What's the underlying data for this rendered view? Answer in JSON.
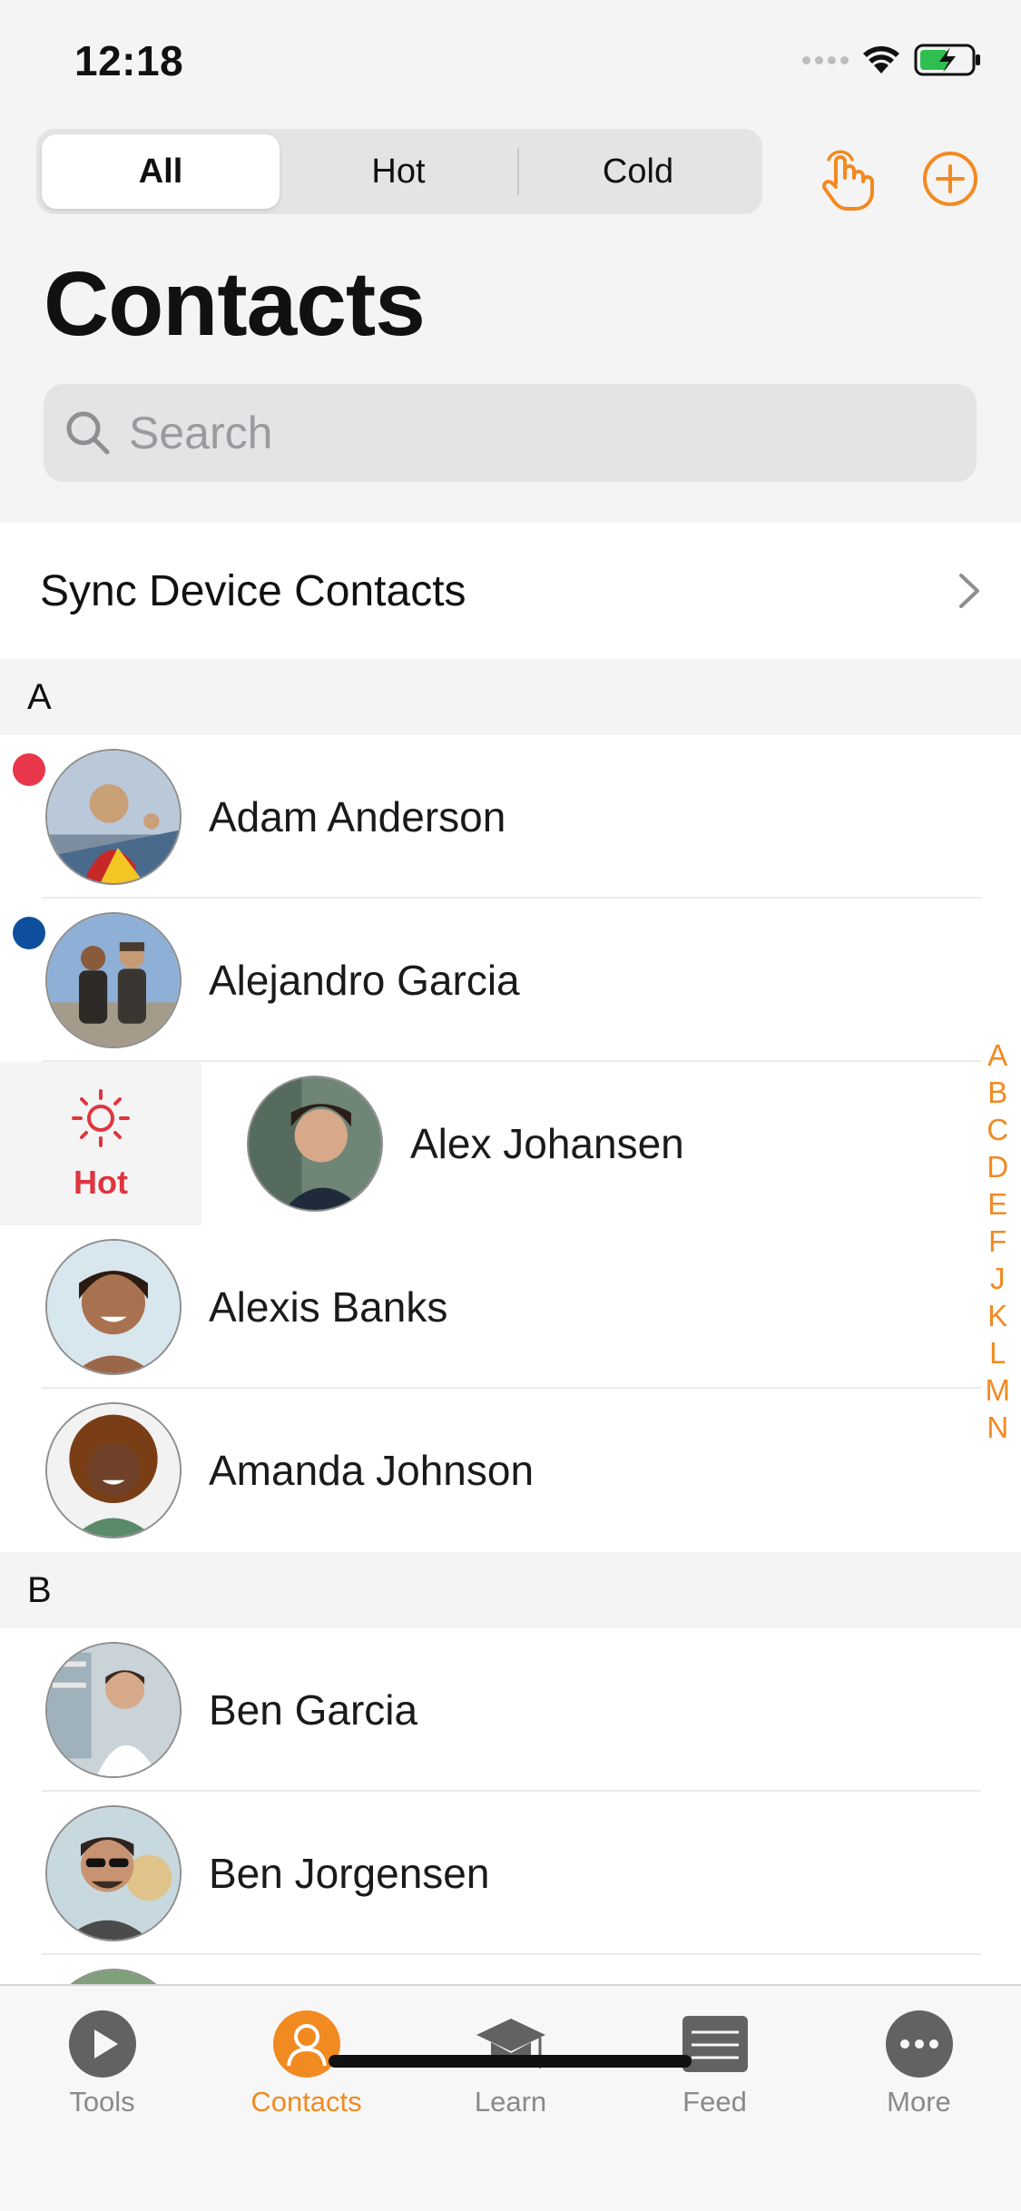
{
  "status_bar": {
    "time": "12:18"
  },
  "segments": {
    "items": [
      "All",
      "Hot",
      "Cold"
    ],
    "selected": "All"
  },
  "header": {
    "title": "Contacts"
  },
  "search": {
    "placeholder": "Search"
  },
  "sync": {
    "label": "Sync Device Contacts"
  },
  "sections": [
    {
      "letter": "A",
      "contacts": [
        {
          "name": "Adam Anderson",
          "dot_color": "#e8364a"
        },
        {
          "name": "Alejandro Garcia",
          "dot_color": "#0d4f9c"
        },
        {
          "name": "Alex Johansen",
          "swipe_action": "Hot"
        },
        {
          "name": "Alexis Banks"
        },
        {
          "name": "Amanda Johnson"
        }
      ]
    },
    {
      "letter": "B",
      "contacts": [
        {
          "name": "Ben Garcia"
        },
        {
          "name": "Ben Jorgensen"
        }
      ]
    }
  ],
  "index_letters": [
    "A",
    "B",
    "C",
    "D",
    "E",
    "F",
    "J",
    "K",
    "L",
    "M",
    "N"
  ],
  "tabbar": {
    "items": [
      {
        "label": "Tools",
        "icon": "play-icon"
      },
      {
        "label": "Contacts",
        "icon": "person-icon",
        "active": true
      },
      {
        "label": "Learn",
        "icon": "graduation-cap-icon"
      },
      {
        "label": "Feed",
        "icon": "feed-icon"
      },
      {
        "label": "More",
        "icon": "more-icon"
      }
    ]
  },
  "colors": {
    "accent": "#f28a22",
    "hot": "#e0353f",
    "background": "#f4f4f4"
  }
}
